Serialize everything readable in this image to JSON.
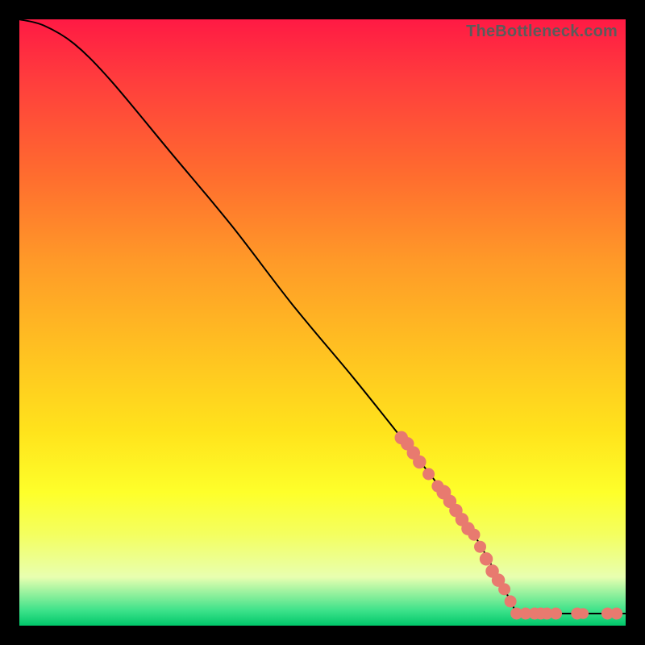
{
  "watermark": "TheBottleneck.com",
  "colors": {
    "point_fill": "#e87a6f",
    "curve_stroke": "#000000"
  },
  "chart_data": {
    "type": "line",
    "title": "",
    "xlabel": "",
    "ylabel": "",
    "xlim": [
      0,
      100
    ],
    "ylim": [
      0,
      100
    ],
    "grid": false,
    "curve": {
      "description": "Smooth monotone-decreasing curve from top-left to bottom-right, flattening at y≈2 near x≈82 then continuing flat to x=100.",
      "approx_points": [
        {
          "x": 0,
          "y": 100
        },
        {
          "x": 4,
          "y": 99
        },
        {
          "x": 9,
          "y": 96
        },
        {
          "x": 15,
          "y": 90
        },
        {
          "x": 25,
          "y": 78
        },
        {
          "x": 35,
          "y": 66
        },
        {
          "x": 45,
          "y": 53
        },
        {
          "x": 55,
          "y": 41
        },
        {
          "x": 63,
          "y": 31
        },
        {
          "x": 70,
          "y": 22
        },
        {
          "x": 75,
          "y": 15
        },
        {
          "x": 80,
          "y": 6
        },
        {
          "x": 82,
          "y": 2
        },
        {
          "x": 100,
          "y": 2
        }
      ]
    },
    "highlighted_points": {
      "description": "Salmon-colored dots overlaid on the lower-right portion of the curve and along the flat tail.",
      "points": [
        {
          "x": 63,
          "y": 31,
          "r": 1.1
        },
        {
          "x": 64,
          "y": 30,
          "r": 1.1
        },
        {
          "x": 65,
          "y": 28.5,
          "r": 1.1
        },
        {
          "x": 66,
          "y": 27,
          "r": 1.1
        },
        {
          "x": 67.5,
          "y": 25,
          "r": 1.0
        },
        {
          "x": 69,
          "y": 23,
          "r": 1.0
        },
        {
          "x": 70,
          "y": 22,
          "r": 1.2
        },
        {
          "x": 71,
          "y": 20.5,
          "r": 1.1
        },
        {
          "x": 72,
          "y": 19,
          "r": 1.1
        },
        {
          "x": 73,
          "y": 17.5,
          "r": 1.1
        },
        {
          "x": 74,
          "y": 16,
          "r": 1.1
        },
        {
          "x": 75,
          "y": 15,
          "r": 1.0
        },
        {
          "x": 76,
          "y": 13,
          "r": 1.0
        },
        {
          "x": 77,
          "y": 11,
          "r": 1.1
        },
        {
          "x": 78,
          "y": 9,
          "r": 1.1
        },
        {
          "x": 79,
          "y": 7.5,
          "r": 1.1
        },
        {
          "x": 80,
          "y": 6,
          "r": 1.0
        },
        {
          "x": 81,
          "y": 4,
          "r": 1.0
        },
        {
          "x": 82,
          "y": 2,
          "r": 1.0
        },
        {
          "x": 83.5,
          "y": 2,
          "r": 1.0
        },
        {
          "x": 85,
          "y": 2,
          "r": 1.0
        },
        {
          "x": 86,
          "y": 2,
          "r": 1.0
        },
        {
          "x": 87,
          "y": 2,
          "r": 1.0
        },
        {
          "x": 88.5,
          "y": 2,
          "r": 1.0
        },
        {
          "x": 92,
          "y": 2,
          "r": 1.0
        },
        {
          "x": 93,
          "y": 2,
          "r": 0.9
        },
        {
          "x": 97,
          "y": 2,
          "r": 1.0
        },
        {
          "x": 98.5,
          "y": 2,
          "r": 1.0
        }
      ]
    }
  }
}
